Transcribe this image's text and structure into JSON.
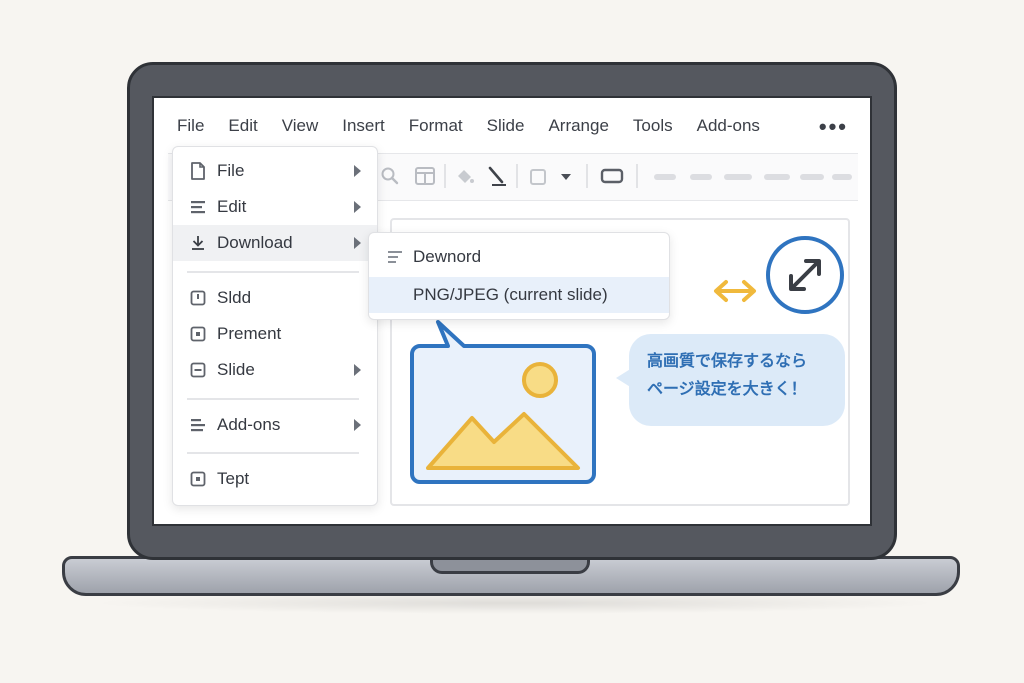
{
  "menubar": {
    "items": [
      "File",
      "Edit",
      "View",
      "Insert",
      "Format",
      "Slide",
      "Arrange",
      "Tools",
      "Add-ons"
    ],
    "more_label": "•••"
  },
  "file_menu": {
    "items": [
      {
        "label": "File",
        "icon": "document-icon",
        "has_submenu": true
      },
      {
        "label": "Edit",
        "icon": "lines-icon",
        "has_submenu": true
      },
      {
        "label": "Download",
        "icon": "download-icon",
        "has_submenu": true,
        "active": true
      },
      {
        "label": "Sldd",
        "icon": "square-bar-icon",
        "has_submenu": false
      },
      {
        "label": "Prement",
        "icon": "square-dot-icon",
        "has_submenu": false
      },
      {
        "label": "Slide",
        "icon": "square-minus-icon",
        "has_submenu": true
      },
      {
        "label": "Add-ons",
        "icon": "lines-icon",
        "has_submenu": true
      },
      {
        "label": "Tept",
        "icon": "square-dot-icon",
        "has_submenu": false
      }
    ]
  },
  "download_submenu": {
    "items": [
      {
        "label": "Dewnord",
        "icon": "lines-icon"
      },
      {
        "label": "PNG/JPEG (current slide)",
        "highlighted": true
      }
    ]
  },
  "tip": {
    "line1": "高画質で保存するなら",
    "line2": "ページ設定を大きく！"
  },
  "colors": {
    "accent_blue": "#2f74c0",
    "image_fill": "#f8dc86",
    "arrow_yellow": "#f0b93c",
    "tip_bg": "#dceaf8"
  }
}
